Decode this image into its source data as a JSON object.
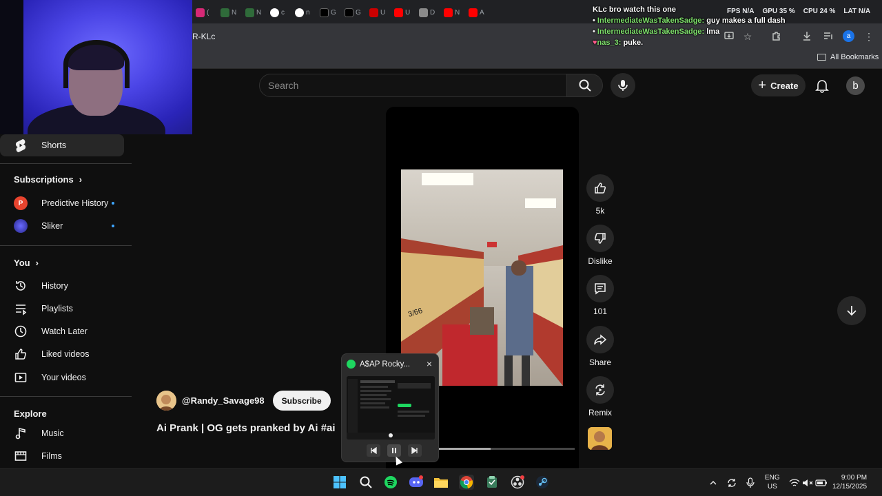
{
  "browser": {
    "url_fragment": "R-KLc",
    "bookmarks_label": "All Bookmarks",
    "tab_favicons": [
      "instagram",
      "trend",
      "trend",
      "google",
      "google",
      "x",
      "x",
      "cnn",
      "youtube",
      "bank",
      "youtube",
      "youtube"
    ],
    "tab_texts": [
      "«",
      "(",
      "N",
      "N",
      "c",
      "n",
      "G",
      "G",
      "U",
      "D",
      "N",
      "A"
    ]
  },
  "overlay_stats": {
    "fps_label": "FPS",
    "fps_value": "N/A",
    "gpu_label": "GPU",
    "gpu_value": "35 %",
    "cpu_label": "CPU",
    "cpu_value": "24 %",
    "lat_label": "LAT",
    "lat_value": "N/A"
  },
  "chat": [
    {
      "user": "KLc bro watch this one",
      "message": ""
    },
    {
      "user": "IntermediateWasTakenSadge:",
      "message": "guy makes a full dash"
    },
    {
      "user": "IntermediateWasTakenSadge:",
      "message": "lma"
    },
    {
      "user": "nas_3:",
      "message": "puke."
    }
  ],
  "header": {
    "search_placeholder": "Search",
    "create_label": "Create",
    "avatar_letter": "b"
  },
  "sidebar": {
    "shorts_label": "Shorts",
    "subscriptions_label": "Subscriptions",
    "subscriptions": [
      {
        "name": "Predictive History",
        "initial": "P",
        "color": "#e8442e"
      },
      {
        "name": "Sliker",
        "initial": "",
        "color": "#3b3bd6"
      }
    ],
    "you_label": "You",
    "you_items": [
      {
        "label": "History",
        "icon": "history-icon"
      },
      {
        "label": "Playlists",
        "icon": "playlists-icon"
      },
      {
        "label": "Watch Later",
        "icon": "clock-icon"
      },
      {
        "label": "Liked videos",
        "icon": "thumbs-up-icon"
      },
      {
        "label": "Your videos",
        "icon": "play-box-icon"
      }
    ],
    "explore_label": "Explore",
    "explore_items": [
      {
        "label": "Music",
        "icon": "music-note-icon"
      },
      {
        "label": "Films",
        "icon": "film-icon"
      }
    ]
  },
  "short": {
    "channel": "@Randy_Savage98",
    "subscribe_label": "Subscribe",
    "title": "Ai Prank | OG gets pranked by Ai #ai",
    "likes": "5k",
    "dislike_label": "Dislike",
    "comments": "101",
    "share_label": "Share",
    "remix_label": "Remix",
    "video_overlay_text": "3/66",
    "progress_fraction": 0.55
  },
  "spotify": {
    "title": "A$AP Rocky...",
    "close": "×"
  },
  "taskbar": {
    "lang_top": "ENG",
    "lang_bottom": "US",
    "time": "9:00 PM",
    "date": "12/15/2025"
  },
  "colors": {
    "yt_bg": "#0f0f0f",
    "chip": "#272727",
    "spotify_green": "#1ed760",
    "chat_user": "#7ee06b"
  }
}
